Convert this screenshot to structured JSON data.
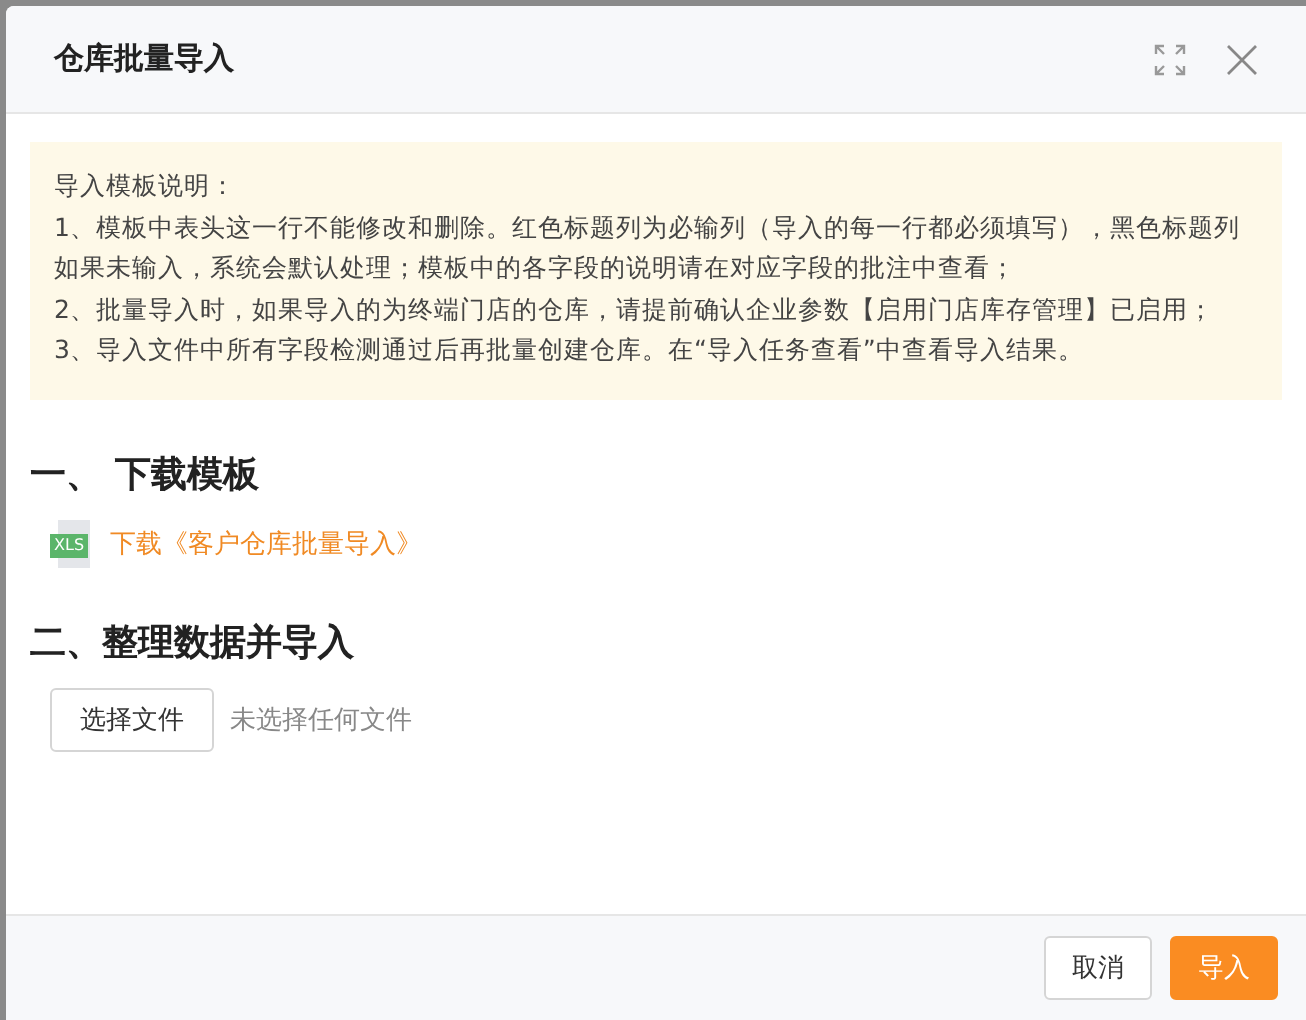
{
  "dialog": {
    "title": "仓库批量导入"
  },
  "notice": {
    "title": "导入模板说明：",
    "items": [
      "1、模板中表头这一行不能修改和删除。红色标题列为必输列（导入的每一行都必须填写），黑色标题列如果未输入，系统会默认处理；模板中的各字段的说明请在对应字段的批注中查看；",
      "2、批量导入时，如果导入的为终端门店的仓库，请提前确认企业参数【启用门店库存管理】已启用；",
      "3、导入文件中所有字段检测通过后再批量创建仓库。在“导入任务查看”中查看导入结果。"
    ]
  },
  "sections": [
    {
      "title": "一、 下载模板",
      "kind": "download",
      "file_type": "XLS",
      "link": "下载《客户仓库批量导入》"
    },
    {
      "title": "二、整理数据并导入",
      "kind": "upload",
      "button": "选择文件",
      "status": "未选择任何文件"
    }
  ],
  "buttons": [
    {
      "label": "取消",
      "primary": false
    },
    {
      "label": "导入",
      "primary": true
    }
  ]
}
